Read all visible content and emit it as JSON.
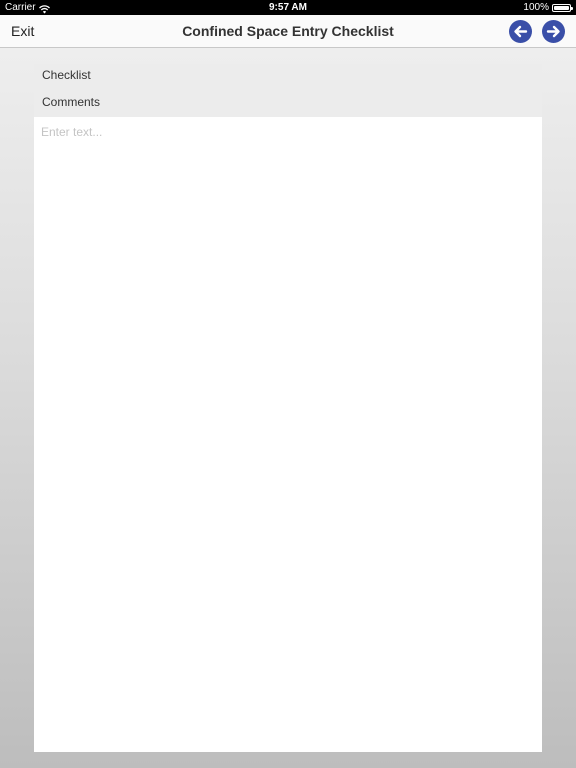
{
  "status_bar": {
    "carrier": "Carrier",
    "wifi_icon": "wifi-icon",
    "time": "9:57 AM",
    "battery_percent": "100%",
    "battery_level": 1.0
  },
  "nav_bar": {
    "exit_label": "Exit",
    "title": "Confined Space Entry Checklist",
    "back_icon": "arrow-left-icon",
    "forward_icon": "arrow-right-icon",
    "arrow_color": "#3a4fa8"
  },
  "form": {
    "section_label": "Checklist",
    "field_label": "Comments",
    "comments_value": "",
    "comments_placeholder": "Enter text..."
  }
}
